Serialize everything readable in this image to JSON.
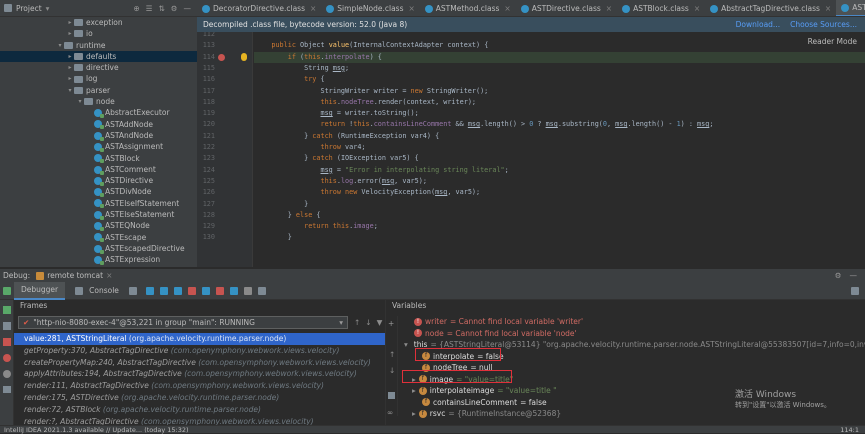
{
  "project": {
    "title": "Project",
    "tree": [
      {
        "label": "exception",
        "indent": 66,
        "kind": "folder",
        "arrow": ">"
      },
      {
        "label": "io",
        "indent": 66,
        "kind": "folder",
        "arrow": ">"
      },
      {
        "label": "runtime",
        "indent": 56,
        "kind": "folder",
        "arrow": "v"
      },
      {
        "label": "defaults",
        "indent": 66,
        "kind": "folder",
        "arrow": ">",
        "selected": true
      },
      {
        "label": "directive",
        "indent": 66,
        "kind": "folder",
        "arrow": ">"
      },
      {
        "label": "log",
        "indent": 66,
        "kind": "folder",
        "arrow": ">"
      },
      {
        "label": "parser",
        "indent": 66,
        "kind": "folder",
        "arrow": "v"
      },
      {
        "label": "node",
        "indent": 76,
        "kind": "folder",
        "arrow": "v"
      },
      {
        "label": "AbstractExecutor",
        "indent": 86,
        "kind": "class"
      },
      {
        "label": "ASTAddNode",
        "indent": 86,
        "kind": "class"
      },
      {
        "label": "ASTAndNode",
        "indent": 86,
        "kind": "class"
      },
      {
        "label": "ASTAssignment",
        "indent": 86,
        "kind": "class"
      },
      {
        "label": "ASTBlock",
        "indent": 86,
        "kind": "class"
      },
      {
        "label": "ASTComment",
        "indent": 86,
        "kind": "class"
      },
      {
        "label": "ASTDirective",
        "indent": 86,
        "kind": "class"
      },
      {
        "label": "ASTDivNode",
        "indent": 86,
        "kind": "class"
      },
      {
        "label": "ASTElseIfStatement",
        "indent": 86,
        "kind": "class"
      },
      {
        "label": "ASTElseStatement",
        "indent": 86,
        "kind": "class"
      },
      {
        "label": "ASTEQNode",
        "indent": 86,
        "kind": "class"
      },
      {
        "label": "ASTEscape",
        "indent": 86,
        "kind": "class"
      },
      {
        "label": "ASTEscapedDirective",
        "indent": 86,
        "kind": "class"
      },
      {
        "label": "ASTExpression",
        "indent": 86,
        "kind": "class"
      }
    ]
  },
  "tabs": [
    {
      "label": "DecoratorDirective.class"
    },
    {
      "label": "SimpleNode.class"
    },
    {
      "label": "ASTMethod.class"
    },
    {
      "label": "ASTDirective.class"
    },
    {
      "label": "ASTBlock.class"
    },
    {
      "label": "AbstractTagDirective.class"
    },
    {
      "label": "ASTStringLiteral.class",
      "active": true
    }
  ],
  "notice": {
    "text": "Decompiled .class file, bytecode version: 52.0 (Java 8)",
    "download": "Download...",
    "choose": "Choose Sources..."
  },
  "reader_mode": "Reader Mode",
  "code": [
    {
      "n": "112",
      "html": ""
    },
    {
      "n": "113",
      "html": "    <span class=\"kw\">public</span> Object <span class=\"fn\">value</span>(InternalContextAdapter context) {"
    },
    {
      "n": "114",
      "html": "        <span class=\"kw\">if</span> (<span class=\"kw\">this</span>.<span class=\"fd\">interpolate</span>) {",
      "hl": true
    },
    {
      "n": "115",
      "html": "            String <u>msg</u>;"
    },
    {
      "n": "116",
      "html": "            <span class=\"kw\">try</span> {"
    },
    {
      "n": "117",
      "html": "                StringWriter writer = <span class=\"kw\">new</span> StringWriter();"
    },
    {
      "n": "118",
      "html": "                <span class=\"kw\">this</span>.<span class=\"fd\">nodeTree</span>.render(context, writer);"
    },
    {
      "n": "119",
      "html": "                <u>msg</u> = writer.toString();"
    },
    {
      "n": "120",
      "html": "                <span class=\"kw\">return</span> !<span class=\"kw\">this</span>.<span class=\"fd\">containsLineComment</span> &amp;&amp; <u>msg</u>.length() &gt; <span class=\"nu\">0</span> ? <u>msg</u>.substring(<span class=\"nu\">0</span>, <u>msg</u>.length() - <span class=\"nu\">1</span>) : <u>msg</u>;"
    },
    {
      "n": "121",
      "html": "            } <span class=\"kw\">catch</span> (RuntimeException var4) {"
    },
    {
      "n": "122",
      "html": "                <span class=\"kw\">throw</span> var4;"
    },
    {
      "n": "123",
      "html": "            } <span class=\"kw\">catch</span> (IOException var5) {"
    },
    {
      "n": "124",
      "html": "                <u>msg</u> = <span class=\"st\">\"Error in interpolating string literal\"</span>;"
    },
    {
      "n": "125",
      "html": "                <span class=\"kw\">this</span>.<span class=\"fd\">log</span>.error(<u>msg</u>, var5);"
    },
    {
      "n": "126",
      "html": "                <span class=\"kw\">throw new</span> VelocityException(<u>msg</u>, var5);"
    },
    {
      "n": "127",
      "html": "            }"
    },
    {
      "n": "128",
      "html": "        } <span class=\"kw\">else</span> {"
    },
    {
      "n": "129",
      "html": "            <span class=\"kw\">return this</span>.<span class=\"fd\">image</span>;"
    },
    {
      "n": "130",
      "html": "        }"
    }
  ],
  "debug": {
    "label": "Debug:",
    "config": "remote tomcat",
    "tabs": {
      "debugger": "Debugger",
      "console": "Console"
    },
    "frames_title": "Frames",
    "variables_title": "Variables",
    "thread": "\"http-nio-8080-exec-4\"@53,221 in group \"main\": RUNNING",
    "frames": [
      {
        "method": "value:281, ASTStringLiteral",
        "pkg": "(org.apache.velocity.runtime.parser.node)",
        "selected": true
      },
      {
        "method": "getProperty:370, AbstractTagDirective",
        "pkg": "(com.openymphony.webwork.views.velocity)"
      },
      {
        "method": "createPropertyMap:240, AbstractTagDirective",
        "pkg": "(com.opensymphony.webwork.views.velocity)"
      },
      {
        "method": "applyAttributes:194, AbstractTagDirective",
        "pkg": "(com.opensymphony.webwork.views.velocity)"
      },
      {
        "method": "render:111, AbstractTagDirective",
        "pkg": "(com.opensymphony.webwork.views.velocity)"
      },
      {
        "method": "render:175, ASTDirective",
        "pkg": "(org.apache.velocity.runtime.parser.node)"
      },
      {
        "method": "render:72, ASTBlock",
        "pkg": "(org.apache.velocity.runtime.parser.node)"
      },
      {
        "method": "render:?, AbstractTagDirective",
        "pkg": "(com.opensymphony.webwork.views.velocity)"
      }
    ],
    "variables": [
      {
        "icon": "err",
        "name": "writer",
        "text": " = Cannot find local variable 'writer'",
        "cls": "vred",
        "indent": 28
      },
      {
        "icon": "err",
        "name": "node",
        "text": " = Cannot find local variable 'node'",
        "cls": "vred",
        "indent": 28
      },
      {
        "icon": "eq",
        "arrow": "v",
        "name": "this",
        "text": " = {ASTStringLiteral@53114} \"org.apache.velocity.runtime.parser.node.ASTStringLiteral@55383507[id=7,info=0,invalid=false...",
        "cls": "vgray",
        "indent": 18
      },
      {
        "icon": "fi",
        "name": "interpolate",
        "text": " = false",
        "cls": "vname",
        "indent": 36
      },
      {
        "icon": "fi",
        "name": "nodeTree",
        "text": " = null",
        "cls": "vname",
        "indent": 36
      },
      {
        "icon": "fi",
        "arrow": ">",
        "name": "image",
        "text": " = \"value=title\"",
        "cls": "vstr",
        "indent": 26
      },
      {
        "icon": "fi",
        "arrow": ">",
        "name": "interpolateimage",
        "text": " = \"value=title \"",
        "cls": "vstr",
        "indent": 26
      },
      {
        "icon": "fi",
        "name": "containsLineComment",
        "text": " = false",
        "cls": "vname",
        "indent": 36
      },
      {
        "icon": "fi",
        "arrow": ">",
        "name": "rsvc",
        "text": " = {RuntimeInstance@52368}",
        "cls": "vgray",
        "indent": 26
      }
    ],
    "this_more": "View"
  },
  "status": {
    "left": "IntelliJ IDEA 2021.1.3 available // Update... (today 15:32)",
    "right": "114:1"
  },
  "watermark": {
    "line1": "激活 Windows",
    "line2": "转到\"设置\"以激活 Windows。"
  }
}
